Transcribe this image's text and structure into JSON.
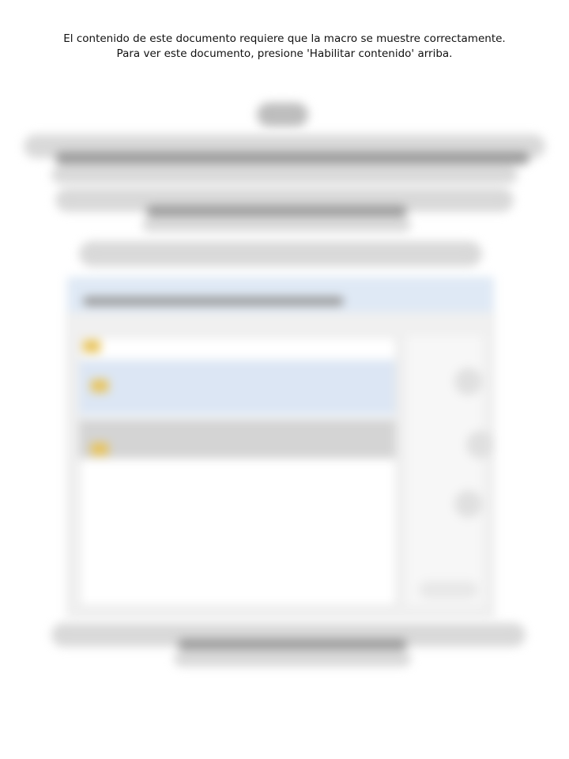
{
  "notice": {
    "line1": "El contenido de este documento requiere que la macro se muestre correctamente.",
    "line2": "Para ver este documento, presione 'Habilitar contenido' arriba."
  }
}
